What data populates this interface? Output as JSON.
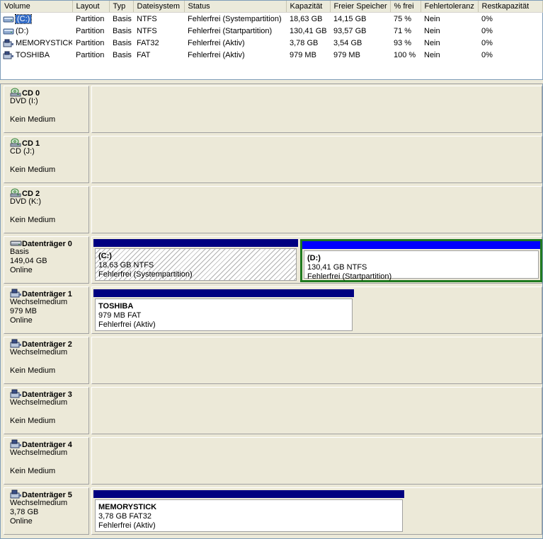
{
  "columns": [
    "Volume",
    "Layout",
    "Typ",
    "Dateisystem",
    "Status",
    "Kapazität",
    "Freier Speicher",
    "% frei",
    "Fehlertoleranz",
    "Restkapazität"
  ],
  "volumes": [
    {
      "name": "(C:)",
      "layout": "Partition",
      "type": "Basis",
      "fs": "NTFS",
      "status": "Fehlerfrei (Systempartition)",
      "capacity": "18,63 GB",
      "free": "14,15 GB",
      "pct": "75 %",
      "ft": "Nein",
      "overhead": "0%",
      "icon": "hard-drive-icon",
      "selected": true
    },
    {
      "name": "(D:)",
      "layout": "Partition",
      "type": "Basis",
      "fs": "NTFS",
      "status": "Fehlerfrei (Startpartition)",
      "capacity": "130,41 GB",
      "free": "93,57 GB",
      "pct": "71 %",
      "ft": "Nein",
      "overhead": "0%",
      "icon": "hard-drive-icon",
      "selected": false
    },
    {
      "name": "MEMORYSTICK",
      "layout": "Partition",
      "type": "Basis",
      "fs": "FAT32",
      "status": "Fehlerfrei (Aktiv)",
      "capacity": "3,78 GB",
      "free": "3,54 GB",
      "pct": "93 %",
      "ft": "Nein",
      "overhead": "0%",
      "icon": "removable-drive-icon",
      "selected": false
    },
    {
      "name": "TOSHIBA",
      "layout": "Partition",
      "type": "Basis",
      "fs": "FAT",
      "status": "Fehlerfrei (Aktiv)",
      "capacity": "979 MB",
      "free": "979 MB",
      "pct": "100 %",
      "ft": "Nein",
      "overhead": "0%",
      "icon": "removable-drive-icon",
      "selected": false
    }
  ],
  "disks": [
    {
      "title": "CD 0",
      "line1": "DVD (I:)",
      "line2": "",
      "line3": "Kein Medium",
      "icon": "cd-drive-icon",
      "partitions": []
    },
    {
      "title": "CD 1",
      "line1": "CD (J:)",
      "line2": "",
      "line3": "Kein Medium",
      "icon": "cd-drive-icon",
      "partitions": []
    },
    {
      "title": "CD 2",
      "line1": "DVD (K:)",
      "line2": "",
      "line3": "Kein Medium",
      "icon": "cd-drive-icon",
      "partitions": []
    },
    {
      "title": "Datenträger 0",
      "line1": "Basis",
      "line2": "149,04 GB",
      "line3": "Online",
      "icon": "hard-disk-icon",
      "partitions": [
        {
          "name": "(C:)",
          "size": "18,63 GB NTFS",
          "status": "Fehlerfrei (Systempartition)",
          "hatched": true,
          "selected": false
        },
        {
          "name": "(D:)",
          "size": "130,41 GB NTFS",
          "status": "Fehlerfrei (Startpartition)",
          "hatched": false,
          "selected": true
        }
      ]
    },
    {
      "title": "Datenträger 1",
      "line1": "Wechselmedium",
      "line2": "979 MB",
      "line3": "Online",
      "icon": "removable-disk-icon",
      "partitions": [
        {
          "name": "TOSHIBA",
          "size": "979 MB FAT",
          "status": "Fehlerfrei (Aktiv)",
          "hatched": false,
          "selected": false
        }
      ]
    },
    {
      "title": "Datenträger 2",
      "line1": "Wechselmedium",
      "line2": "",
      "line3": "Kein Medium",
      "icon": "removable-disk-icon",
      "partitions": []
    },
    {
      "title": "Datenträger 3",
      "line1": "Wechselmedium",
      "line2": "",
      "line3": "Kein Medium",
      "icon": "removable-disk-icon",
      "partitions": []
    },
    {
      "title": "Datenträger 4",
      "line1": "Wechselmedium",
      "line2": "",
      "line3": "Kein Medium",
      "icon": "removable-disk-icon",
      "partitions": []
    },
    {
      "title": "Datenträger 5",
      "line1": "Wechselmedium",
      "line2": "3,78 GB",
      "line3": "Online",
      "icon": "removable-disk-icon",
      "partitions": [
        {
          "name": "MEMORYSTICK",
          "size": "3,78 GB FAT32",
          "status": "Fehlerfrei (Aktiv)",
          "hatched": false,
          "selected": false
        }
      ]
    }
  ],
  "colors": {
    "partition_bar": "#000080",
    "selected_bar": "#0000ff",
    "selected_border": "#1f7a1f",
    "background": "#ece9d8"
  }
}
